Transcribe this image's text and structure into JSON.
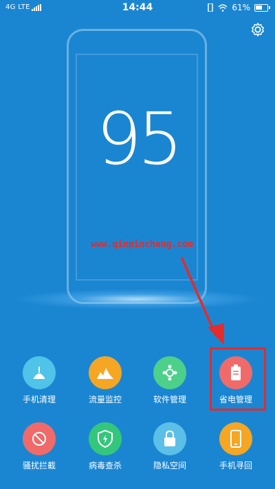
{
  "status_bar": {
    "network": "4G LTE",
    "time": "14:44",
    "battery_percent": "61%"
  },
  "score": "95",
  "watermark": "www.qinpinchang.com",
  "colors": {
    "background": "#1a86d2",
    "highlight": "#e52b2b"
  },
  "tools": [
    {
      "label": "手机清理",
      "icon": "broom-icon",
      "color": "#4fc3e8"
    },
    {
      "label": "流量监控",
      "icon": "traffic-chart-icon",
      "color": "#f5a623"
    },
    {
      "label": "软件管理",
      "icon": "app-manager-icon",
      "color": "#4cd08a"
    },
    {
      "label": "省电管理",
      "icon": "battery-icon",
      "color": "#f06a6a"
    },
    {
      "label": "骚扰拦截",
      "icon": "block-icon",
      "color": "#f06a6a"
    },
    {
      "label": "病毒查杀",
      "icon": "shield-icon",
      "color": "#34c77b"
    },
    {
      "label": "隐私空间",
      "icon": "lock-icon",
      "color": "#5bbfe8"
    },
    {
      "label": "手机寻回",
      "icon": "phone-icon",
      "color": "#f5a623"
    }
  ]
}
